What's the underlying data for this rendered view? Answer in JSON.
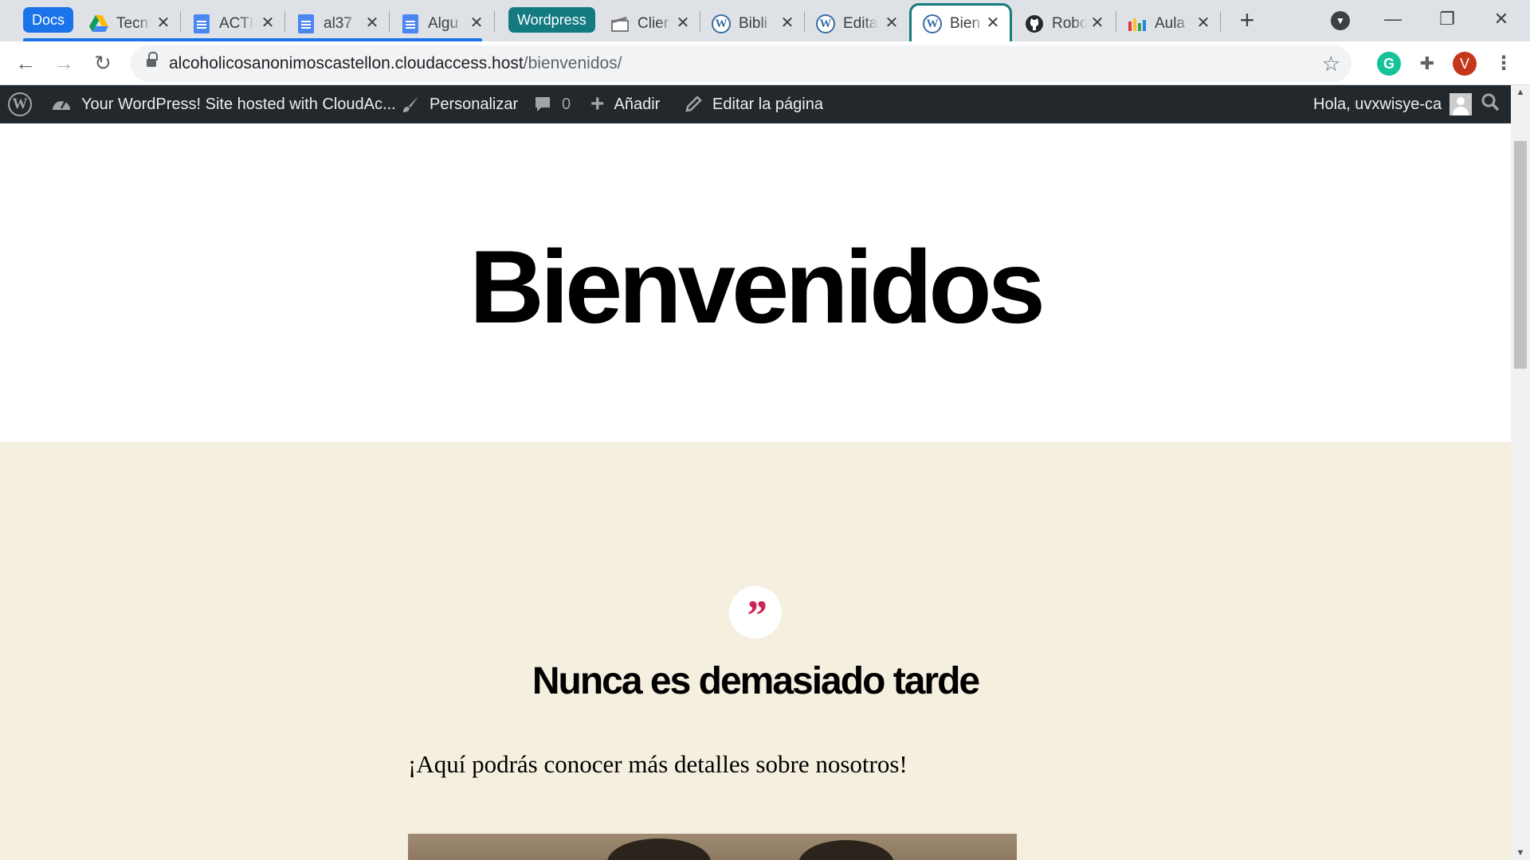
{
  "browser": {
    "tab_groups": [
      {
        "label": "Docs",
        "color": "#1a73e8"
      },
      {
        "label": "Wordpress",
        "color": "#137a7f"
      }
    ],
    "tabs": [
      {
        "title": "Tecn",
        "icon": "google-drive-icon"
      },
      {
        "title": "ACTI",
        "icon": "google-docs-icon"
      },
      {
        "title": "al37",
        "icon": "google-docs-icon"
      },
      {
        "title": "Algu",
        "icon": "google-docs-icon"
      },
      {
        "title": "Clier",
        "icon": "clapperboard-icon"
      },
      {
        "title": "Bibli",
        "icon": "wordpress-icon"
      },
      {
        "title": "Edita",
        "icon": "wordpress-icon"
      },
      {
        "title": "Bien",
        "icon": "wordpress-icon",
        "active": true
      },
      {
        "title": "Robo",
        "icon": "github-icon"
      },
      {
        "title": "Aula",
        "icon": "aula-icon"
      }
    ],
    "url_host": "alcoholicosanonimoscastellon.cloudaccess.host",
    "url_path": "/bienvenidos/",
    "profile_initial": "V"
  },
  "adminbar": {
    "site_name": "Your WordPress! Site hosted with CloudAc...",
    "customize": "Personalizar",
    "comments_count": "0",
    "add_new": "Añadir",
    "edit_page": "Editar la página",
    "greeting": "Hola, uvxwisye-ca"
  },
  "page": {
    "title": "Bienvenidos",
    "quote_mark": "”",
    "cover_heading": "Nunca es demasiado tarde",
    "cover_text": "¡Aquí podrás conocer más detalles sobre nosotros!"
  },
  "colors": {
    "group_docs": "#1a73e8",
    "group_wordpress": "#137a7f",
    "adminbar_bg": "#23282d",
    "cover_bg": "#f5efe0",
    "accent": "#cd2653"
  }
}
